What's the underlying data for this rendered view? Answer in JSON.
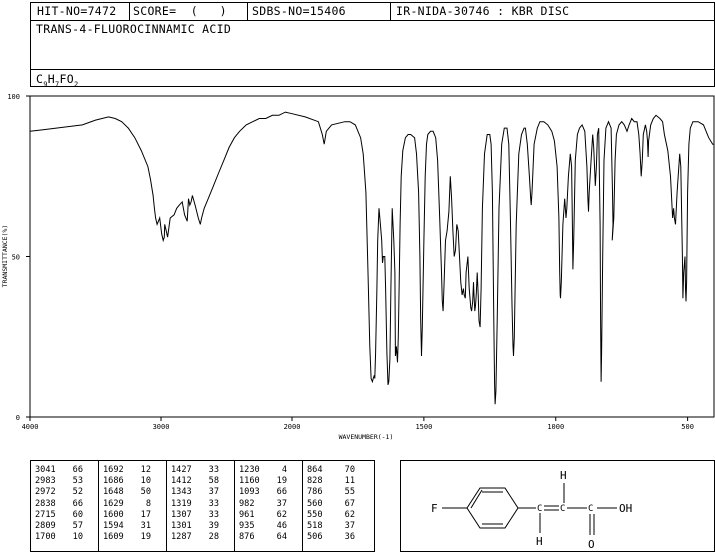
{
  "header": {
    "hit_no": "HIT-NO=7472",
    "score": "SCORE=  (   )",
    "sdbs_no": "SDBS-NO=15406",
    "ir_nida": "IR-NIDA-30746 : KBR DISC",
    "compound_name": "TRANS-4-FLUOROCINNAMIC ACID",
    "formula": {
      "c": "C",
      "n1": "9",
      "h": "H",
      "n2": "7",
      "rest": "FO",
      "n3": "2"
    }
  },
  "chart_data": {
    "type": "line",
    "xlabel": "WAVENUMBER(-1)",
    "ylabel": "TRANSMITTANCE(%)",
    "xlim": [
      4000,
      400
    ],
    "ylim": [
      0,
      100
    ],
    "x_ticks": [
      4000,
      3000,
      2000,
      1500,
      1000,
      500
    ],
    "y_ticks": [
      0,
      50,
      100
    ],
    "x_tick_labels": [
      "4000",
      "3000",
      "2000",
      "1500",
      "1000",
      "500"
    ],
    "y_tick_labels": [
      "0",
      "50",
      "100"
    ],
    "series": [
      {
        "points": [
          [
            4000,
            89
          ],
          [
            3900,
            89.5
          ],
          [
            3800,
            90
          ],
          [
            3700,
            90.5
          ],
          [
            3600,
            91
          ],
          [
            3500,
            92.5
          ],
          [
            3400,
            93.5
          ],
          [
            3350,
            93
          ],
          [
            3300,
            92
          ],
          [
            3250,
            90
          ],
          [
            3200,
            87
          ],
          [
            3150,
            83
          ],
          [
            3100,
            78
          ],
          [
            3080,
            74
          ],
          [
            3060,
            69
          ],
          [
            3050,
            65
          ],
          [
            3041,
            62
          ],
          [
            3030,
            60
          ],
          [
            3010,
            62
          ],
          [
            2995,
            57
          ],
          [
            2983,
            55
          ],
          [
            2975,
            56
          ],
          [
            2972,
            60
          ],
          [
            2960,
            58
          ],
          [
            2950,
            56
          ],
          [
            2930,
            62
          ],
          [
            2900,
            63
          ],
          [
            2880,
            65
          ],
          [
            2860,
            66
          ],
          [
            2838,
            67
          ],
          [
            2820,
            63
          ],
          [
            2800,
            61
          ],
          [
            2790,
            68
          ],
          [
            2780,
            66
          ],
          [
            2770,
            67
          ],
          [
            2760,
            69
          ],
          [
            2740,
            66
          ],
          [
            2715,
            62
          ],
          [
            2700,
            60
          ],
          [
            2690,
            62
          ],
          [
            2670,
            65
          ],
          [
            2640,
            68
          ],
          [
            2600,
            72
          ],
          [
            2560,
            76
          ],
          [
            2520,
            80
          ],
          [
            2480,
            84
          ],
          [
            2440,
            87
          ],
          [
            2400,
            89
          ],
          [
            2350,
            91
          ],
          [
            2300,
            92
          ],
          [
            2250,
            93
          ],
          [
            2200,
            93
          ],
          [
            2150,
            94
          ],
          [
            2100,
            94
          ],
          [
            2050,
            95
          ],
          [
            2000,
            94.5
          ],
          [
            1950,
            93.5
          ],
          [
            1900,
            92
          ],
          [
            1885,
            88
          ],
          [
            1878,
            85
          ],
          [
            1870,
            89
          ],
          [
            1850,
            91
          ],
          [
            1800,
            92
          ],
          [
            1780,
            92
          ],
          [
            1760,
            91
          ],
          [
            1740,
            87
          ],
          [
            1730,
            82
          ],
          [
            1720,
            70
          ],
          [
            1712,
            45
          ],
          [
            1705,
            22
          ],
          [
            1700,
            12
          ],
          [
            1695,
            11
          ],
          [
            1692,
            12
          ],
          [
            1688,
            13
          ],
          [
            1686,
            12
          ],
          [
            1683,
            20
          ],
          [
            1678,
            40
          ],
          [
            1675,
            55
          ],
          [
            1670,
            65
          ],
          [
            1665,
            60
          ],
          [
            1660,
            55
          ],
          [
            1657,
            48
          ],
          [
            1654,
            50
          ],
          [
            1648,
            50
          ],
          [
            1645,
            40
          ],
          [
            1640,
            20
          ],
          [
            1636,
            10
          ],
          [
            1633,
            11
          ],
          [
            1629,
            18
          ],
          [
            1625,
            40
          ],
          [
            1620,
            65
          ],
          [
            1617,
            60
          ],
          [
            1614,
            55
          ],
          [
            1610,
            45
          ],
          [
            1608,
            19
          ],
          [
            1604,
            22
          ],
          [
            1600,
            17
          ],
          [
            1597,
            25
          ],
          [
            1594,
            40
          ],
          [
            1590,
            60
          ],
          [
            1586,
            75
          ],
          [
            1580,
            83
          ],
          [
            1570,
            87
          ],
          [
            1560,
            88
          ],
          [
            1550,
            88
          ],
          [
            1535,
            87
          ],
          [
            1528,
            82
          ],
          [
            1520,
            70
          ],
          [
            1515,
            50
          ],
          [
            1512,
            30
          ],
          [
            1509,
            19
          ],
          [
            1506,
            28
          ],
          [
            1500,
            55
          ],
          [
            1495,
            75
          ],
          [
            1490,
            85
          ],
          [
            1485,
            88
          ],
          [
            1475,
            89
          ],
          [
            1465,
            89
          ],
          [
            1455,
            87
          ],
          [
            1448,
            80
          ],
          [
            1440,
            62
          ],
          [
            1433,
            45
          ],
          [
            1430,
            36
          ],
          [
            1427,
            33
          ],
          [
            1424,
            40
          ],
          [
            1418,
            55
          ],
          [
            1412,
            58
          ],
          [
            1405,
            64
          ],
          [
            1400,
            75
          ],
          [
            1395,
            68
          ],
          [
            1390,
            58
          ],
          [
            1385,
            50
          ],
          [
            1380,
            52
          ],
          [
            1375,
            60
          ],
          [
            1370,
            58
          ],
          [
            1365,
            50
          ],
          [
            1360,
            42
          ],
          [
            1355,
            38
          ],
          [
            1350,
            40
          ],
          [
            1347,
            38
          ],
          [
            1343,
            37
          ],
          [
            1340,
            45
          ],
          [
            1333,
            50
          ],
          [
            1328,
            40
          ],
          [
            1322,
            34
          ],
          [
            1319,
            33
          ],
          [
            1315,
            36
          ],
          [
            1312,
            42
          ],
          [
            1310,
            38
          ],
          [
            1307,
            33
          ],
          [
            1304,
            35
          ],
          [
            1301,
            39
          ],
          [
            1298,
            45
          ],
          [
            1294,
            38
          ],
          [
            1291,
            30
          ],
          [
            1287,
            28
          ],
          [
            1283,
            40
          ],
          [
            1278,
            65
          ],
          [
            1270,
            82
          ],
          [
            1260,
            88
          ],
          [
            1250,
            88
          ],
          [
            1245,
            85
          ],
          [
            1240,
            70
          ],
          [
            1235,
            30
          ],
          [
            1232,
            10
          ],
          [
            1230,
            4
          ],
          [
            1227,
            8
          ],
          [
            1222,
            30
          ],
          [
            1215,
            65
          ],
          [
            1205,
            85
          ],
          [
            1195,
            90
          ],
          [
            1185,
            90
          ],
          [
            1178,
            85
          ],
          [
            1172,
            62
          ],
          [
            1166,
            35
          ],
          [
            1162,
            22
          ],
          [
            1160,
            19
          ],
          [
            1157,
            25
          ],
          [
            1150,
            60
          ],
          [
            1140,
            82
          ],
          [
            1130,
            88
          ],
          [
            1120,
            90
          ],
          [
            1115,
            90
          ],
          [
            1108,
            85
          ],
          [
            1100,
            75
          ],
          [
            1095,
            68
          ],
          [
            1093,
            66
          ],
          [
            1090,
            70
          ],
          [
            1082,
            85
          ],
          [
            1070,
            90
          ],
          [
            1060,
            92
          ],
          [
            1045,
            92
          ],
          [
            1030,
            91
          ],
          [
            1015,
            89
          ],
          [
            1005,
            86
          ],
          [
            995,
            78
          ],
          [
            988,
            62
          ],
          [
            985,
            45
          ],
          [
            983,
            38
          ],
          [
            982,
            37
          ],
          [
            979,
            42
          ],
          [
            973,
            60
          ],
          [
            966,
            68
          ],
          [
            961,
            62
          ],
          [
            958,
            65
          ],
          [
            952,
            75
          ],
          [
            945,
            82
          ],
          [
            940,
            78
          ],
          [
            937,
            60
          ],
          [
            935,
            46
          ],
          [
            932,
            55
          ],
          [
            926,
            80
          ],
          [
            918,
            88
          ],
          [
            910,
            90
          ],
          [
            900,
            91
          ],
          [
            890,
            89
          ],
          [
            882,
            78
          ],
          [
            878,
            68
          ],
          [
            876,
            64
          ],
          [
            873,
            70
          ],
          [
            866,
            80
          ],
          [
            860,
            88
          ],
          [
            856,
            84
          ],
          [
            852,
            76
          ],
          [
            850,
            72
          ],
          [
            846,
            78
          ],
          [
            842,
            88
          ],
          [
            837,
            90
          ],
          [
            832,
            60
          ],
          [
            830,
            30
          ],
          [
            828,
            11
          ],
          [
            826,
            20
          ],
          [
            822,
            50
          ],
          [
            817,
            80
          ],
          [
            810,
            90
          ],
          [
            800,
            92
          ],
          [
            790,
            90
          ],
          [
            785,
            70
          ],
          [
            783,
            60
          ],
          [
            786,
            55
          ],
          [
            780,
            62
          ],
          [
            775,
            80
          ],
          [
            770,
            88
          ],
          [
            760,
            91
          ],
          [
            750,
            92
          ],
          [
            740,
            91
          ],
          [
            730,
            89
          ],
          [
            722,
            91
          ],
          [
            712,
            93
          ],
          [
            702,
            92
          ],
          [
            692,
            92
          ],
          [
            685,
            88
          ],
          [
            680,
            82
          ],
          [
            676,
            75
          ],
          [
            672,
            80
          ],
          [
            668,
            88
          ],
          [
            660,
            91
          ],
          [
            655,
            89
          ],
          [
            652,
            86
          ],
          [
            650,
            81
          ],
          [
            648,
            86
          ],
          [
            640,
            91
          ],
          [
            630,
            93
          ],
          [
            620,
            94
          ],
          [
            605,
            93
          ],
          [
            595,
            92
          ],
          [
            588,
            88
          ],
          [
            575,
            83
          ],
          [
            565,
            75
          ],
          [
            560,
            67
          ],
          [
            557,
            62
          ],
          [
            553,
            65
          ],
          [
            550,
            62
          ],
          [
            546,
            60
          ],
          [
            540,
            70
          ],
          [
            530,
            82
          ],
          [
            526,
            78
          ],
          [
            520,
            50
          ],
          [
            518,
            37
          ],
          [
            515,
            45
          ],
          [
            510,
            50
          ],
          [
            508,
            40
          ],
          [
            506,
            36
          ],
          [
            504,
            42
          ],
          [
            500,
            70
          ],
          [
            495,
            85
          ],
          [
            490,
            90
          ],
          [
            480,
            92
          ],
          [
            460,
            92
          ],
          [
            440,
            91
          ],
          [
            420,
            87
          ],
          [
            405,
            85
          ],
          [
            400,
            85
          ]
        ]
      }
    ]
  },
  "peak_table": [
    [
      "3041",
      "66",
      "1692",
      "12",
      "1427",
      "33",
      "1230",
      "4",
      "864",
      "70"
    ],
    [
      "2983",
      "53",
      "1686",
      "10",
      "1412",
      "58",
      "1160",
      "19",
      "828",
      "11"
    ],
    [
      "2972",
      "52",
      "1648",
      "50",
      "1343",
      "37",
      "1093",
      "66",
      "786",
      "55"
    ],
    [
      "2838",
      "66",
      "1629",
      "8",
      "1319",
      "33",
      "982",
      "37",
      "560",
      "67"
    ],
    [
      "2715",
      "60",
      "1600",
      "17",
      "1307",
      "33",
      "961",
      "62",
      "550",
      "62"
    ],
    [
      "2809",
      "57",
      "1594",
      "31",
      "1301",
      "39",
      "935",
      "46",
      "518",
      "37"
    ],
    [
      "1700",
      "10",
      "1609",
      "19",
      "1287",
      "28",
      "876",
      "64",
      "506",
      "36"
    ]
  ],
  "structure": {
    "labels": {
      "f": "F",
      "h_top": "H",
      "h_bottom": "H",
      "o": "O",
      "oh": "OH"
    }
  }
}
